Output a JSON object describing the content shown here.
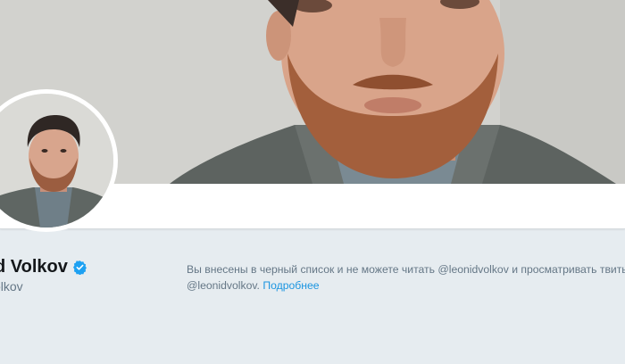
{
  "profile": {
    "name": "d Volkov",
    "handle": "volkov"
  },
  "blocked_notice": {
    "line1": "Вы внесены в черный список и не можете читать @leonidvolkov и просматривать твиты",
    "line2_prefix": "@leonidvolkov. ",
    "learn_more_label": "Подробнее"
  },
  "colors": {
    "page_background": "#e6ecf0",
    "link": "#1b95e0",
    "verified_badge": "#1da1f2",
    "secondary_text": "#657786",
    "primary_text": "#14171a"
  },
  "icons": {
    "verified": "verified-badge-icon"
  }
}
